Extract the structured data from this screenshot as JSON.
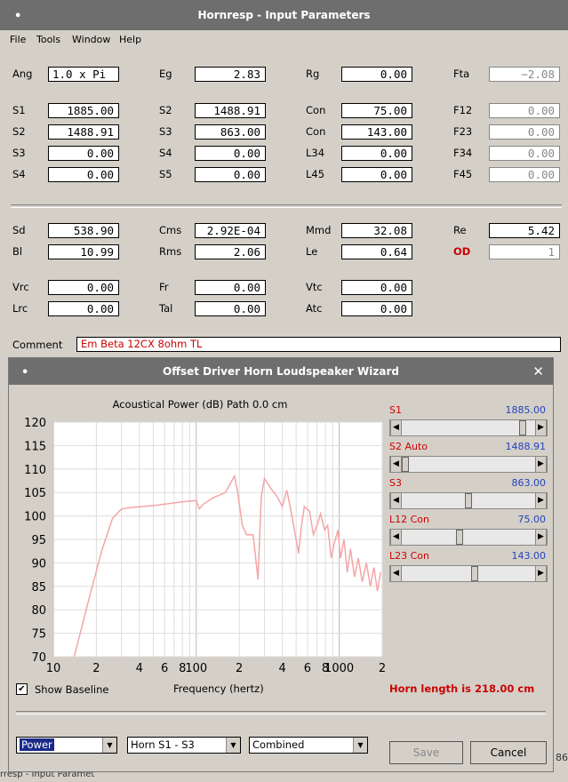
{
  "main": {
    "title": "Hornresp - Input Parameters",
    "menu": [
      "File",
      "Tools",
      "Window",
      "Help"
    ],
    "rows1": [
      {
        "l1": "Ang",
        "v1": "1.0 x Pi",
        "l2": "Eg",
        "v2": "2.83",
        "l3": "Rg",
        "v3": "0.00",
        "l4": "Fta",
        "v4": "−2.08"
      }
    ],
    "rows2": [
      {
        "l1": "S1",
        "v1": "1885.00",
        "l2": "S2",
        "v2": "1488.91",
        "l3": "Con",
        "v3": "75.00",
        "l4": "F12",
        "v4": "0.00"
      },
      {
        "l1": "S2",
        "v1": "1488.91",
        "l2": "S3",
        "v2": "863.00",
        "l3": "Con",
        "v3": "143.00",
        "l4": "F23",
        "v4": "0.00"
      },
      {
        "l1": "S3",
        "v1": "0.00",
        "l2": "S4",
        "v2": "0.00",
        "l3": "L34",
        "v3": "0.00",
        "l4": "F34",
        "v4": "0.00"
      },
      {
        "l1": "S4",
        "v1": "0.00",
        "l2": "S5",
        "v2": "0.00",
        "l3": "L45",
        "v3": "0.00",
        "l4": "F45",
        "v4": "0.00"
      }
    ],
    "rows3": [
      {
        "l1": "Sd",
        "v1": "538.90",
        "l2": "Cms",
        "v2": "2.92E-04",
        "l3": "Mmd",
        "v3": "32.08",
        "l4": "Re",
        "v4": "5.42"
      },
      {
        "l1": "Bl",
        "v1": "10.99",
        "l2": "Rms",
        "v2": "2.06",
        "l3": "Le",
        "v3": "0.64",
        "l4": "OD",
        "v4": "1"
      }
    ],
    "rows4": [
      {
        "l1": "Vrc",
        "v1": "0.00",
        "l2": "Fr",
        "v2": "0.00",
        "l3": "Vtc",
        "v3": "0.00"
      },
      {
        "l1": "Lrc",
        "v1": "0.00",
        "l2": "Tal",
        "v2": "0.00",
        "l3": "Atc",
        "v3": "0.00"
      }
    ],
    "comment_label": "Comment",
    "comment_value": "Em Beta 12CX 8ohm TL",
    "bottom_text": "rresp - Input Paramet",
    "side_right_text": "86"
  },
  "wizard": {
    "title": "Offset Driver Horn Loudspeaker Wizard",
    "chart_title": "Acoustical Power (dB)   Path 0.0 cm",
    "sliders": [
      {
        "label": "S1",
        "value": "1885.00",
        "pos": 0.93
      },
      {
        "label": "S2 Auto",
        "value": "1488.91",
        "pos": 0.0
      },
      {
        "label": "S3",
        "value": "863.00",
        "pos": 0.5
      },
      {
        "label": "L12 Con",
        "value": "75.00",
        "pos": 0.43
      },
      {
        "label": "L23 Con",
        "value": "143.00",
        "pos": 0.55
      }
    ],
    "show_baseline": "Show Baseline",
    "horn_length": "Horn length is 218.00 cm",
    "combo1": "Power",
    "combo2": "Horn S1 - S3",
    "combo3": "Combined",
    "save": "Save",
    "cancel": "Cancel"
  },
  "chart_data": {
    "type": "line",
    "title": "Acoustical Power (dB)   Path 0.0 cm",
    "xlabel": "Frequency (hertz)",
    "ylabel": "",
    "xscale": "log",
    "xlim": [
      10,
      2000
    ],
    "ylim": [
      70,
      120
    ],
    "yticks": [
      70,
      75,
      80,
      85,
      90,
      95,
      100,
      105,
      110,
      115,
      120
    ],
    "xtick_labels": [
      {
        "x": 10,
        "label": "10"
      },
      {
        "x": 20,
        "label": "2"
      },
      {
        "x": 40,
        "label": "4"
      },
      {
        "x": 60,
        "label": "6"
      },
      {
        "x": 80,
        "label": "8"
      },
      {
        "x": 100,
        "label": "100"
      },
      {
        "x": 200,
        "label": "2"
      },
      {
        "x": 400,
        "label": "4"
      },
      {
        "x": 600,
        "label": "6"
      },
      {
        "x": 800,
        "label": "8"
      },
      {
        "x": 1000,
        "label": "1000"
      },
      {
        "x": 2000,
        "label": "2"
      }
    ],
    "grid": true,
    "color": "#f4a6a6",
    "series": [
      {
        "points": [
          [
            14,
            70
          ],
          [
            18,
            83
          ],
          [
            22,
            93
          ],
          [
            26,
            99.5
          ],
          [
            30,
            101.5
          ],
          [
            35,
            101.8
          ],
          [
            50,
            102.2
          ],
          [
            80,
            103
          ],
          [
            100,
            103.3
          ],
          [
            105,
            101.5
          ],
          [
            112,
            102.5
          ],
          [
            130,
            103.8
          ],
          [
            160,
            105
          ],
          [
            185,
            108.5
          ],
          [
            195,
            105
          ],
          [
            210,
            98
          ],
          [
            225,
            96
          ],
          [
            250,
            96
          ],
          [
            270,
            86.5
          ],
          [
            285,
            104
          ],
          [
            300,
            108
          ],
          [
            330,
            106
          ],
          [
            370,
            104
          ],
          [
            400,
            102
          ],
          [
            430,
            105.5
          ],
          [
            460,
            101
          ],
          [
            520,
            92
          ],
          [
            540,
            97
          ],
          [
            570,
            102
          ],
          [
            620,
            101
          ],
          [
            660,
            96
          ],
          [
            700,
            98
          ],
          [
            740,
            100.5
          ],
          [
            790,
            97
          ],
          [
            830,
            98
          ],
          [
            880,
            91
          ],
          [
            920,
            94
          ],
          [
            980,
            97
          ],
          [
            1020,
            91
          ],
          [
            1080,
            95
          ],
          [
            1140,
            88
          ],
          [
            1200,
            93
          ],
          [
            1280,
            87
          ],
          [
            1360,
            91
          ],
          [
            1450,
            86
          ],
          [
            1550,
            90
          ],
          [
            1650,
            85
          ],
          [
            1750,
            89
          ],
          [
            1850,
            84
          ],
          [
            1950,
            88
          ]
        ]
      }
    ]
  }
}
